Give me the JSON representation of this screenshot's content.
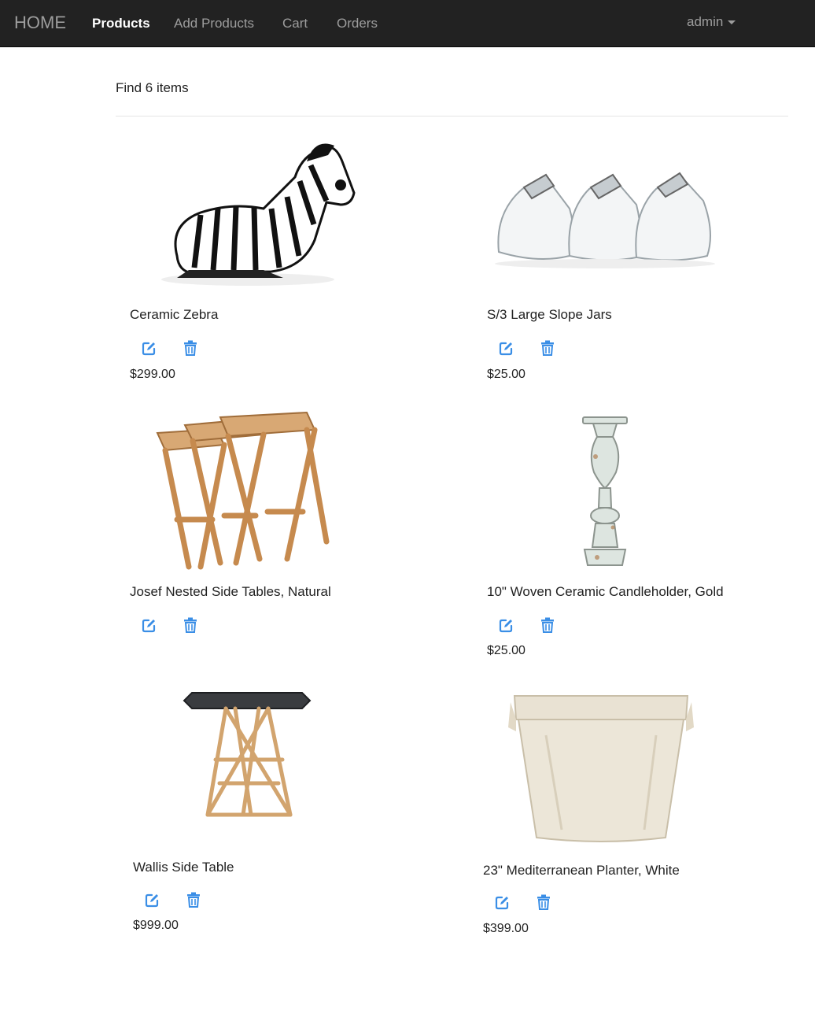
{
  "nav": {
    "brand": "HOME",
    "links": [
      "Products",
      "Add Products",
      "Cart",
      "Orders"
    ],
    "active": "Products",
    "user": "admin"
  },
  "main": {
    "result_count": "Find 6 items"
  },
  "products": [
    {
      "name": "Ceramic Zebra",
      "price": "$299.00"
    },
    {
      "name": "S/3 Large Slope Jars",
      "price": "$25.00"
    },
    {
      "name": "Josef Nested Side Tables, Natural",
      "price": ""
    },
    {
      "name": "10\" Woven Ceramic Candleholder, Gold",
      "price": "$25.00"
    },
    {
      "name": "Wallis Side Table",
      "price": "$999.00"
    },
    {
      "name": "23\" Mediterranean Planter, White",
      "price": "$399.00"
    }
  ],
  "icons": {
    "edit": "edit-icon",
    "delete": "trash-icon"
  },
  "colors": {
    "navbar": "#222222",
    "nav_text": "#9d9d9d",
    "nav_active": "#ffffff",
    "action_icon": "#3a8ee6"
  }
}
